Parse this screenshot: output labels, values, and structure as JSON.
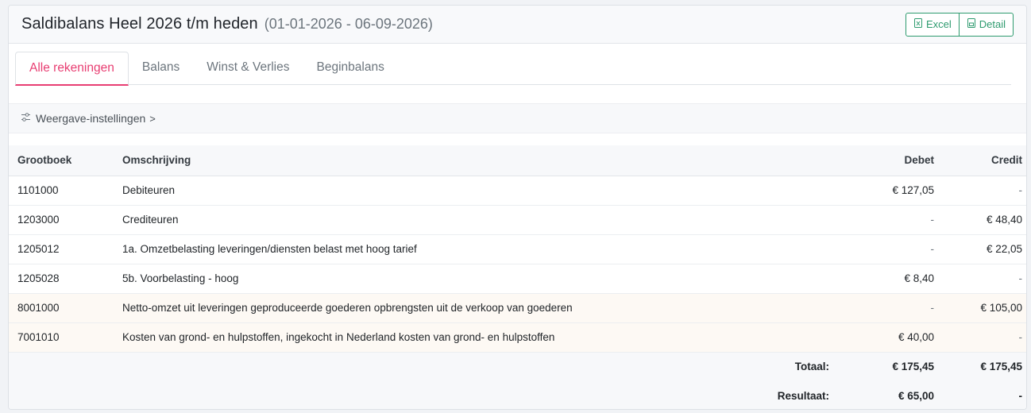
{
  "header": {
    "title": "Saldibalans Heel 2026 t/m heden",
    "range": "(01-01-2026 - 06-09-2026)",
    "excel_label": "Excel",
    "detail_label": "Detail"
  },
  "tabs": [
    {
      "label": "Alle rekeningen",
      "active": true
    },
    {
      "label": "Balans",
      "active": false
    },
    {
      "label": "Winst & Verlies",
      "active": false
    },
    {
      "label": "Beginbalans",
      "active": false
    }
  ],
  "settings": {
    "label": "Weergave-instellingen",
    "chevron": ">"
  },
  "table": {
    "columns": {
      "grootboek": "Grootboek",
      "omschrijving": "Omschrijving",
      "debet": "Debet",
      "credit": "Credit"
    },
    "rows": [
      {
        "grootboek": "1101000",
        "omschrijving": "Debiteuren",
        "debet": "€ 127,05",
        "credit": "-"
      },
      {
        "grootboek": "1203000",
        "omschrijving": "Crediteuren",
        "debet": "-",
        "credit": "€ 48,40"
      },
      {
        "grootboek": "1205012",
        "omschrijving": "1a. Omzetbelasting leveringen/diensten belast met hoog tarief",
        "debet": "-",
        "credit": "€ 22,05"
      },
      {
        "grootboek": "1205028",
        "omschrijving": "5b. Voorbelasting - hoog",
        "debet": "€ 8,40",
        "credit": "-"
      },
      {
        "grootboek": "8001000",
        "omschrijving": "Netto-omzet uit leveringen geproduceerde goederen opbrengsten uit de verkoop van goederen",
        "debet": "-",
        "credit": "€ 105,00"
      },
      {
        "grootboek": "7001010",
        "omschrijving": "Kosten van grond- en hulpstoffen, ingekocht in Nederland kosten van grond- en hulpstoffen",
        "debet": "€ 40,00",
        "credit": "-"
      }
    ],
    "totals": {
      "label": "Totaal:",
      "debet": "€ 175,45",
      "credit": "€ 175,45"
    },
    "result": {
      "label": "Resultaat:",
      "debet": "€ 65,00",
      "credit": "-"
    }
  },
  "colors": {
    "accent": "#e83e72",
    "excel_green": "#2e9b6f"
  },
  "icons": {
    "excel": "file-excel-icon",
    "detail": "file-detail-icon",
    "settings": "sliders-icon"
  }
}
